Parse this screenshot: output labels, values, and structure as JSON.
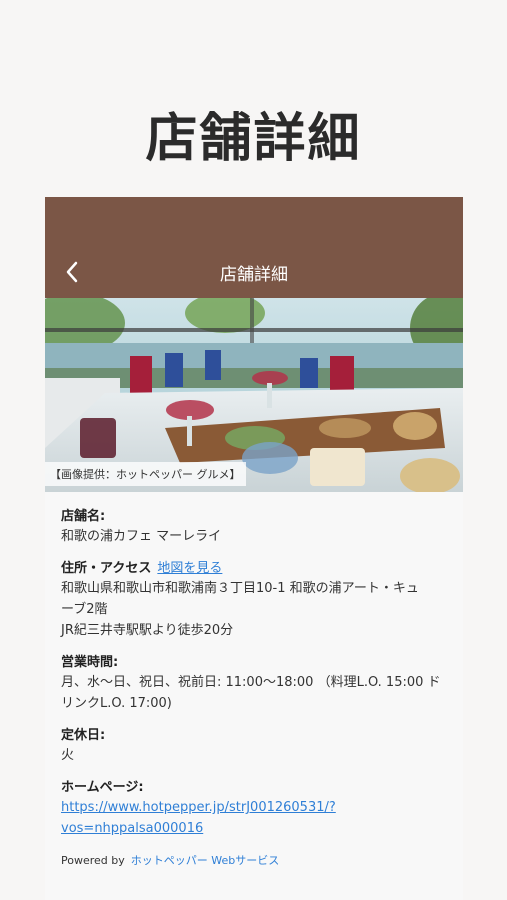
{
  "page": {
    "hero_title": "店舗詳細"
  },
  "navbar": {
    "title": "店舗詳細",
    "back_icon": "chevron-left-icon",
    "background": "#7b5646"
  },
  "photo": {
    "credit": "【画像提供：ホットペッパー グルメ】"
  },
  "details": {
    "name_label": "店舗名:",
    "name_value": "和歌の浦カフェ マーレライ",
    "address_label": "住所・アクセス",
    "map_link": "地図を見る",
    "address_line1": "和歌山県和歌山市和歌浦南３丁目10-1 和歌の浦アート・キュ",
    "address_line2": "ーブ2階",
    "access": "JR紀三井寺駅駅より徒歩20分",
    "hours_label": "営業時間:",
    "hours_line1": "月、水～日、祝日、祝前日: 11:00～18:00 （料理L.O. 15:00 ド",
    "hours_line2": "リンクL.O. 17:00)",
    "closed_label": "定休日:",
    "closed_value": "火",
    "homepage_label": "ホームページ:",
    "homepage_line1": "https://www.hotpepper.jp/strJ001260531/?",
    "homepage_line2": "vos=nhppalsa000016"
  },
  "footer": {
    "powered_by": "Powered by",
    "service_link": "ホットペッパー Webサービス"
  },
  "colors": {
    "accent_link": "#2f7fd6",
    "nav_brown": "#7b5646"
  }
}
